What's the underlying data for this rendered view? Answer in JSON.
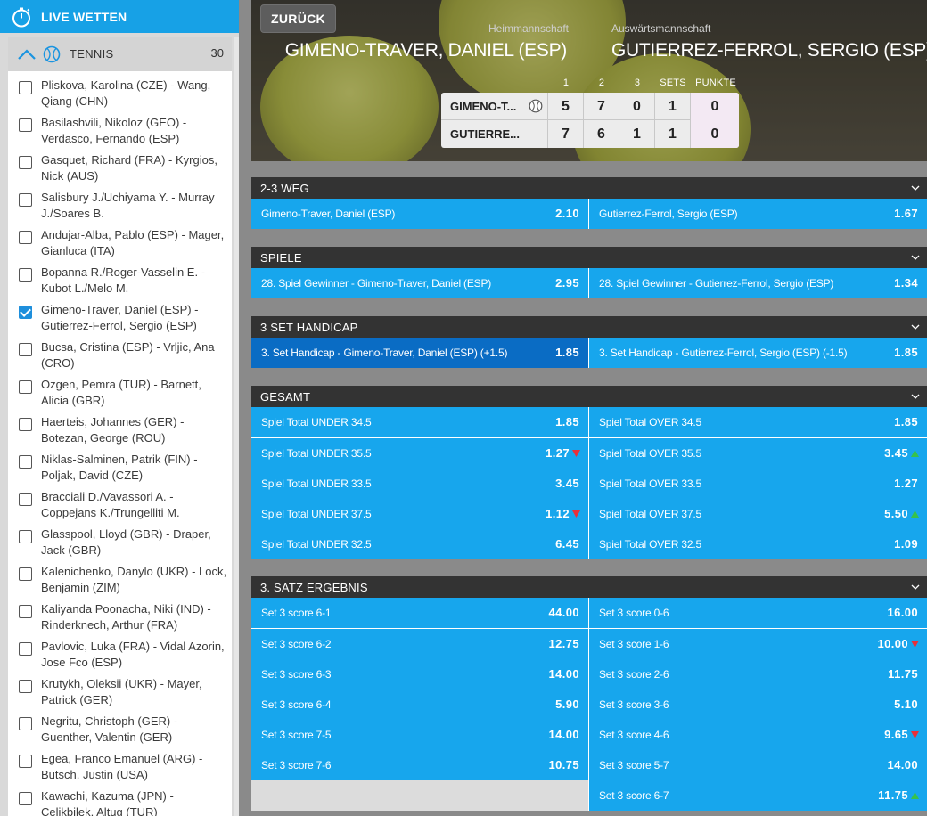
{
  "sidebar": {
    "header_label": "LIVE WETTEN",
    "sport": {
      "name": "TENNIS",
      "count": "30"
    },
    "matches": [
      {
        "name": "Pliskova, Karolina (CZE) - Wang, Qiang (CHN)",
        "checked": false
      },
      {
        "name": "Basilashvili, Nikoloz (GEO) - Verdasco, Fernando (ESP)",
        "checked": false
      },
      {
        "name": "Gasquet, Richard (FRA) - Kyrgios, Nick (AUS)",
        "checked": false
      },
      {
        "name": "Salisbury J./Uchiyama Y. - Murray J./Soares B.",
        "checked": false
      },
      {
        "name": "Andujar-Alba, Pablo (ESP) - Mager, Gianluca (ITA)",
        "checked": false
      },
      {
        "name": "Bopanna R./Roger-Vasselin E. - Kubot L./Melo M.",
        "checked": false
      },
      {
        "name": "Gimeno-Traver, Daniel (ESP) - Gutierrez-Ferrol, Sergio (ESP)",
        "checked": true
      },
      {
        "name": "Bucsa, Cristina (ESP) - Vrljic, Ana (CRO)",
        "checked": false
      },
      {
        "name": "Ozgen, Pemra (TUR) - Barnett, Alicia (GBR)",
        "checked": false
      },
      {
        "name": "Haerteis, Johannes (GER) - Botezan, George (ROU)",
        "checked": false
      },
      {
        "name": "Niklas-Salminen, Patrik (FIN) - Poljak, David (CZE)",
        "checked": false
      },
      {
        "name": "Bracciali D./Vavassori A. - Coppejans K./Trungelliti M.",
        "checked": false
      },
      {
        "name": "Glasspool, Lloyd (GBR) - Draper, Jack (GBR)",
        "checked": false
      },
      {
        "name": "Kalenichenko, Danylo (UKR) - Lock, Benjamin (ZIM)",
        "checked": false
      },
      {
        "name": "Kaliyanda Poonacha, Niki (IND) - Rinderknech, Arthur (FRA)",
        "checked": false
      },
      {
        "name": "Pavlovic, Luka (FRA) - Vidal Azorin, Jose Fco (ESP)",
        "checked": false
      },
      {
        "name": "Krutykh, Oleksii (UKR) - Mayer, Patrick (GER)",
        "checked": false
      },
      {
        "name": "Negritu, Christoph (GER) - Guenther, Valentin (GER)",
        "checked": false
      },
      {
        "name": "Egea, Franco Emanuel (ARG) - Butsch, Justin (USA)",
        "checked": false
      },
      {
        "name": "Kawachi, Kazuma (JPN) - Celikbilek, Altug (TUR)",
        "checked": false
      }
    ]
  },
  "event": {
    "back_label": "ZURÜCK",
    "home_label": "Heimmannschaft",
    "away_label": "Auswärtsmannschaft",
    "home_name": "GIMENO-TRAVER, DANIEL (ESP)",
    "away_name": "GUTIERREZ-FERROL, SERGIO (ESP)",
    "score_headers": [
      "1",
      "2",
      "3",
      "SETS",
      "PUNKTE"
    ],
    "players": [
      {
        "short": "GIMENO-T...",
        "serving": true,
        "scores": [
          "5",
          "7",
          "0",
          "1",
          "0"
        ]
      },
      {
        "short": "GUTIERRE...",
        "serving": false,
        "scores": [
          "7",
          "6",
          "1",
          "1",
          "0"
        ]
      }
    ]
  },
  "markets": [
    {
      "title": "2-3 WEG",
      "rows": [
        [
          {
            "label": "Gimeno-Traver, Daniel (ESP)",
            "odd": "2.10"
          },
          {
            "label": "Gutierrez-Ferrol, Sergio (ESP)",
            "odd": "1.67"
          }
        ]
      ]
    },
    {
      "title": "SPIELE",
      "rows": [
        [
          {
            "label": "28. Spiel Gewinner - Gimeno-Traver, Daniel (ESP)",
            "odd": "2.95"
          },
          {
            "label": "28. Spiel Gewinner - Gutierrez-Ferrol, Sergio (ESP)",
            "odd": "1.34"
          }
        ]
      ]
    },
    {
      "title": "3 SET HANDICAP",
      "rows": [
        [
          {
            "label": "3. Set Handicap - Gimeno-Traver, Daniel (ESP) (+1.5)",
            "odd": "1.85",
            "selected": true
          },
          {
            "label": "3. Set Handicap - Gutierrez-Ferrol, Sergio (ESP) (-1.5)",
            "odd": "1.85"
          }
        ]
      ]
    },
    {
      "title": "GESAMT",
      "rows": [
        [
          {
            "label": "Spiel Total UNDER 34.5",
            "odd": "1.85"
          },
          {
            "label": "Spiel Total OVER 34.5",
            "odd": "1.85"
          }
        ],
        [
          {
            "label": "Spiel Total UNDER 35.5",
            "odd": "1.27",
            "trend": "down"
          },
          {
            "label": "Spiel Total OVER 35.5",
            "odd": "3.45",
            "trend": "up"
          }
        ],
        [
          {
            "label": "Spiel Total UNDER 33.5",
            "odd": "3.45"
          },
          {
            "label": "Spiel Total OVER 33.5",
            "odd": "1.27"
          }
        ],
        [
          {
            "label": "Spiel Total UNDER 37.5",
            "odd": "1.12",
            "trend": "down"
          },
          {
            "label": "Spiel Total OVER 37.5",
            "odd": "5.50",
            "trend": "up"
          }
        ],
        [
          {
            "label": "Spiel Total UNDER 32.5",
            "odd": "6.45"
          },
          {
            "label": "Spiel Total OVER 32.5",
            "odd": "1.09"
          }
        ]
      ]
    },
    {
      "title": "3. SATZ ERGEBNIS",
      "rows": [
        [
          {
            "label": "Set 3 score 6-1",
            "odd": "44.00"
          },
          {
            "label": "Set 3 score 0-6",
            "odd": "16.00"
          }
        ],
        [
          {
            "label": "Set 3 score 6-2",
            "odd": "12.75"
          },
          {
            "label": "Set 3 score 1-6",
            "odd": "10.00",
            "trend": "down"
          }
        ],
        [
          {
            "label": "Set 3 score 6-3",
            "odd": "14.00"
          },
          {
            "label": "Set 3 score 2-6",
            "odd": "11.75"
          }
        ],
        [
          {
            "label": "Set 3 score 6-4",
            "odd": "5.90"
          },
          {
            "label": "Set 3 score 3-6",
            "odd": "5.10"
          }
        ],
        [
          {
            "label": "Set 3 score 7-5",
            "odd": "14.00"
          },
          {
            "label": "Set 3 score 4-6",
            "odd": "9.65",
            "trend": "down"
          }
        ],
        [
          {
            "label": "Set 3 score 7-6",
            "odd": "10.75"
          },
          {
            "label": "Set 3 score 5-7",
            "odd": "14.00"
          }
        ],
        [
          null,
          {
            "label": "Set 3 score 6-7",
            "odd": "11.75",
            "trend": "up"
          }
        ]
      ]
    }
  ],
  "colors": {
    "accent": "#17a6ed",
    "selected": "#0a6cc4",
    "market_header": "#333333",
    "trend_down": "#e8303a",
    "trend_up": "#37c24a"
  }
}
